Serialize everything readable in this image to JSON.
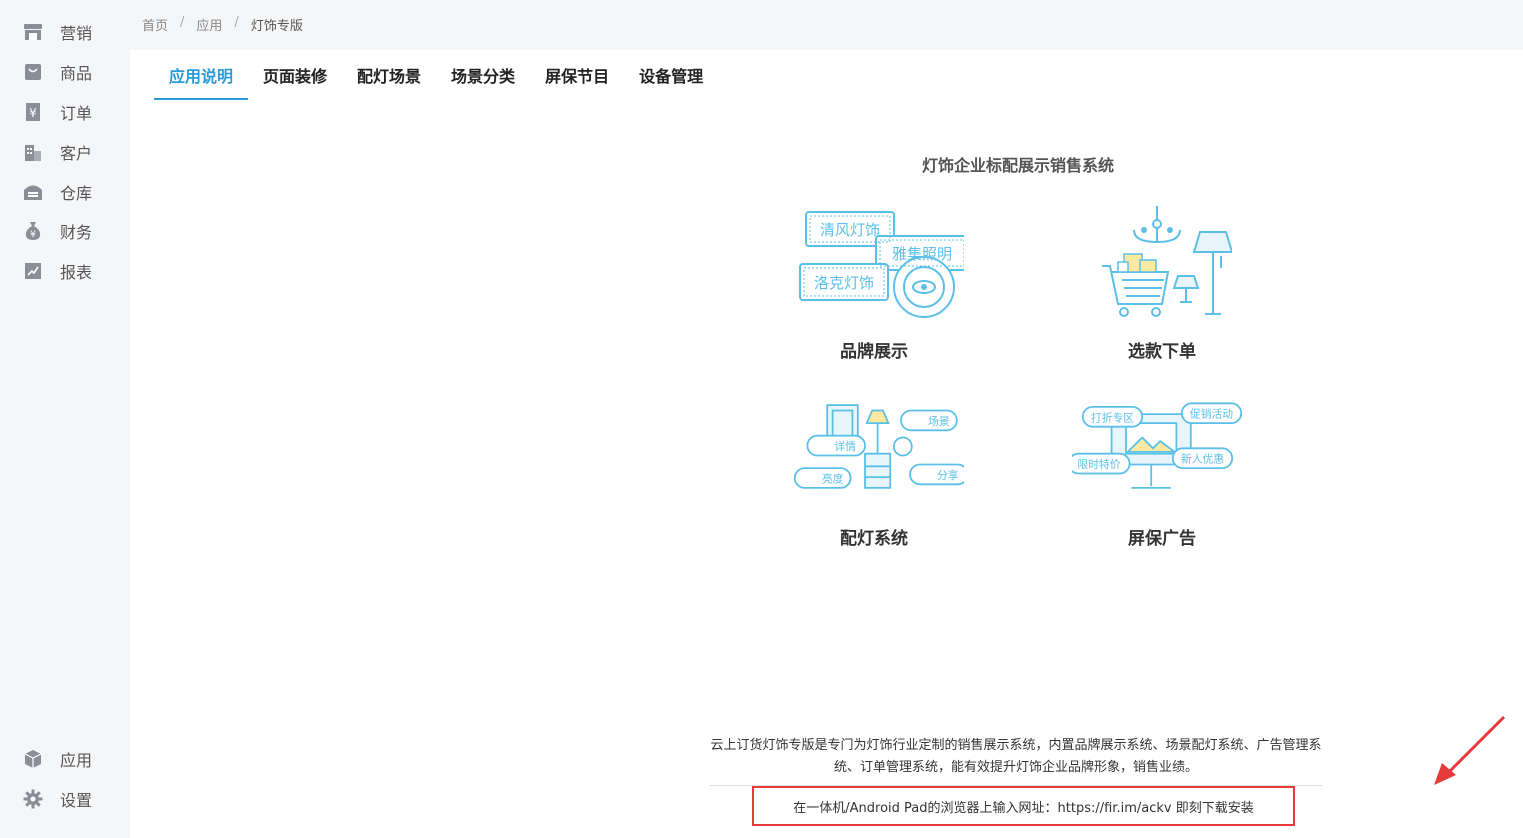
{
  "sidebar": {
    "items": [
      {
        "label": "营销",
        "icon": "store-icon"
      },
      {
        "label": "商品",
        "icon": "bag-icon"
      },
      {
        "label": "订单",
        "icon": "yen-doc-icon"
      },
      {
        "label": "客户",
        "icon": "building-icon"
      },
      {
        "label": "仓库",
        "icon": "warehouse-icon"
      },
      {
        "label": "财务",
        "icon": "money-bag-icon"
      },
      {
        "label": "报表",
        "icon": "chart-icon"
      }
    ],
    "bottom": [
      {
        "label": "应用",
        "icon": "cube-icon"
      },
      {
        "label": "设置",
        "icon": "gear-icon"
      }
    ]
  },
  "breadcrumb": {
    "home": "首页",
    "app": "应用",
    "current": "灯饰专版",
    "sep": "/"
  },
  "tabs": [
    "应用说明",
    "页面装修",
    "配灯场景",
    "场景分类",
    "屏保节目",
    "设备管理"
  ],
  "content": {
    "title": "灯饰企业标配展示销售系统",
    "features": [
      {
        "caption": "品牌展示",
        "tags": [
          "清风灯饰",
          "雅集照明",
          "洛克灯饰"
        ]
      },
      {
        "caption": "选款下单"
      },
      {
        "caption": "配灯系统",
        "tags": [
          "场景",
          "详情",
          "亮度",
          "分享"
        ]
      },
      {
        "caption": "屏保广告",
        "tags": [
          "打折专区",
          "促销活动",
          "限时特价",
          "新人优惠"
        ]
      }
    ],
    "description": "云上订货灯饰专版是专门为灯饰行业定制的销售展示系统，内置品牌展示系统、场景配灯系统、广告管理系统、订单管理系统，能有效提升灯饰企业品牌形象，销售业绩。",
    "download": "在一体机/Android Pad的浏览器上输入网址：https://fir.im/ackv 即刻下载安装"
  },
  "colors": {
    "accent": "#2a9bd8",
    "illustration": "#5bc0e8",
    "highlight": "#e63b3b"
  }
}
